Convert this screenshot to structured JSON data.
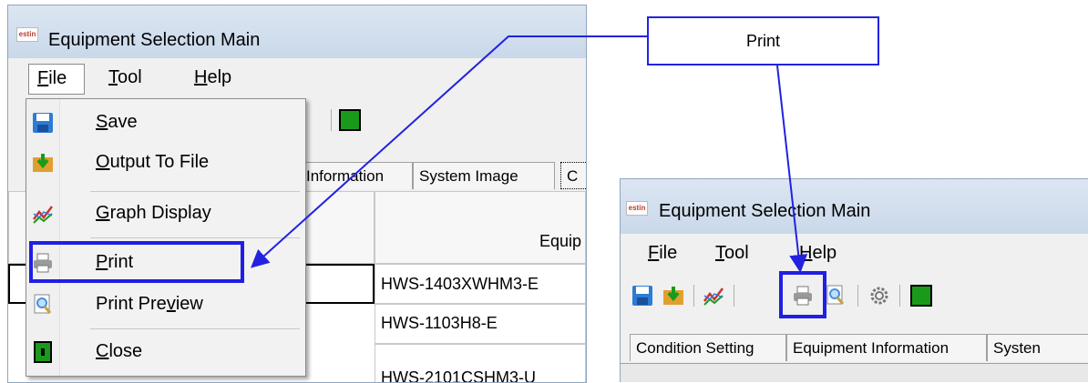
{
  "left_window": {
    "logo_text": "estin",
    "title": "Equipment Selection Main",
    "menu": [
      {
        "label": "File",
        "mnemonic": "F",
        "rest": "ile"
      },
      {
        "label": "Tool",
        "mnemonic": "T",
        "rest": "ool"
      },
      {
        "label": "Help",
        "mnemonic": "H",
        "rest": "elp"
      }
    ],
    "tabs_visible": [
      "Information",
      "System Image",
      "C"
    ],
    "grid": {
      "header": "Equip",
      "rows": [
        "HWS-1403XWHM3-E",
        "HWS-1103H8-E",
        "HWS-2101CSHM3-U"
      ]
    },
    "file_menu": [
      {
        "label": "Save",
        "mnemonic": "S",
        "rest": "ave",
        "icon": "save-icon",
        "color": "#2e7bd6"
      },
      {
        "label": "Output To File",
        "mnemonic": "O",
        "rest": "utput To File",
        "icon": "export-icon",
        "color": "#e0a030"
      },
      {
        "label": "Graph Display",
        "mnemonic": "G",
        "rest": "raph Display",
        "icon": "graph-icon",
        "color": "#cc3333"
      },
      {
        "label": "Print",
        "mnemonic": "P",
        "rest": "rint",
        "icon": "printer-icon",
        "color": "#808080"
      },
      {
        "label": "Print Preview",
        "pre": "Print Pre",
        "mnemonic": "v",
        "rest": "iew",
        "icon": "print-preview-icon",
        "color": "#4a90d9"
      },
      {
        "label": "Close",
        "mnemonic": "C",
        "rest": "lose",
        "icon": "exit-icon",
        "color": "#1a9a1a"
      }
    ]
  },
  "right_window": {
    "logo_text": "estin",
    "title": "Equipment Selection Main",
    "menu": [
      {
        "label": "File",
        "mnemonic": "F",
        "rest": "ile"
      },
      {
        "label": "Tool",
        "mnemonic": "T",
        "rest": "ool"
      },
      {
        "label": "Help",
        "mnemonic": "H",
        "rest": "elp"
      }
    ],
    "tabs": [
      "Condition Setting",
      "Equipment Information",
      "Systen"
    ]
  },
  "callout": {
    "text": "Print"
  },
  "colors": {
    "highlight": "#1f1fe6",
    "accent": "#2222e0"
  }
}
